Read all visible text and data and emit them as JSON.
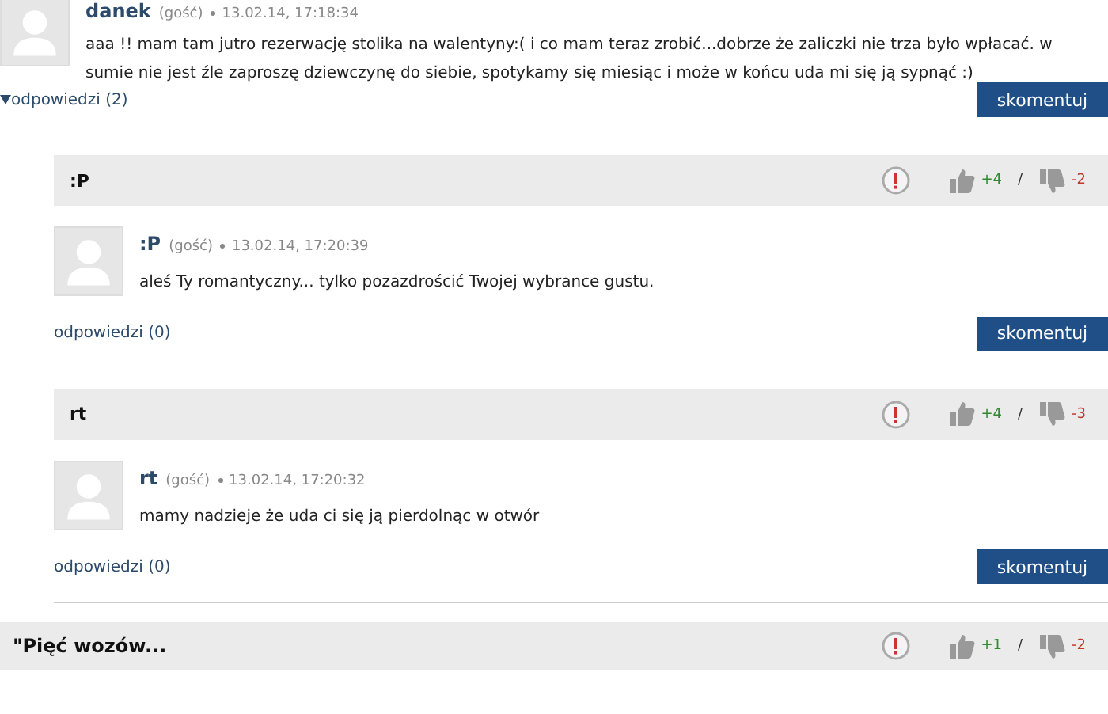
{
  "comment": {
    "author": "danek",
    "guest_label": "(gość)",
    "date": "13.02.14, 17:18:34",
    "text": "aaa !! mam tam jutro rezerwację stolika na walentyny:( i co mam teraz zrobić...dobrze że zaliczki nie trza było wpłacać. w sumie nie jest źle zaproszę dziewczynę do siebie, spotykamy się miesiąc i może w końcu uda mi się ją sypnąć :)",
    "replies_label": "odpowiedzi (2)",
    "expanded": true,
    "button": "skomentuj"
  },
  "replies": [
    {
      "title": ":P",
      "up": "+4",
      "separator": "/",
      "down": "-2",
      "author": ":P",
      "guest_label": "(gość)",
      "date": "13.02.14, 17:20:39",
      "text": "aleś Ty romantyczny... tylko pozazdrościć Twojej wybrance gustu.",
      "replies_label": "odpowiedzi (0)",
      "button": "skomentuj"
    },
    {
      "title": "rt",
      "up": "+4",
      "separator": "/",
      "down": "-3",
      "author": "rt",
      "guest_label": "(gość)",
      "date": "13.02.14, 17:20:32",
      "text": "mamy nadzieje że uda ci się ją pierdolnąc w otwór",
      "replies_label": "odpowiedzi (0)",
      "button": "skomentuj"
    }
  ],
  "next_comment": {
    "title": "\"Pięć wozów...",
    "up": "+1",
    "separator": "/",
    "down": "-2"
  }
}
